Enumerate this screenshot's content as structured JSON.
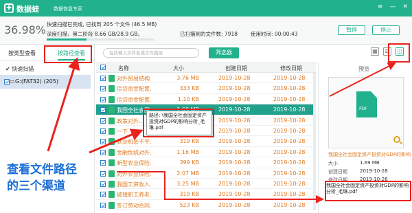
{
  "app": {
    "logo_glyph": "✚",
    "title": "数据蛙",
    "subtitle": "数据恢复专家",
    "controls": [
      "≡",
      "—",
      "✕"
    ]
  },
  "scan": {
    "percent": "36.98%",
    "line1": "快速扫描已完成, 已找到 205 个文件 (46.5 MB)",
    "line2": "深度扫描，第二阶段 8.66 GB/28.9 GB。",
    "progress_fraction": 0.3698,
    "found": "已扫描到的文件数:  7918",
    "time_used": "使用时间:  00:00:43",
    "pause_label": "暂停",
    "stop_label": "停止"
  },
  "left_panel": {
    "tab_type": "按类型查看",
    "tab_path": "按路径查看",
    "quick_scan": "快速扫描",
    "drive_label": "G:(FAT32) (205)"
  },
  "toolbar": {
    "search_placeholder": "在此输入文件名或文件路径",
    "filter_label": "筛选器",
    "view_icons": [
      "▦",
      "☰",
      "◫"
    ]
  },
  "table": {
    "columns": [
      "名称",
      "大小",
      "创建日期",
      "修改日期"
    ],
    "rows": [
      {
        "name": "对外贸易结构...",
        "size": "3.76 MB",
        "created": "2019-10-28",
        "modified": "2019-10-28",
        "selected": false
      },
      {
        "name": "信贷资金配置...",
        "size": "333 KB",
        "created": "2019-10-28",
        "modified": "2019-10-28",
        "selected": false
      },
      {
        "name": "信贷资金配置...",
        "size": "1.10 KB",
        "created": "2019-10-28",
        "modified": "2019-10-28",
        "selected": false
      },
      {
        "name": "我国全社会固...",
        "size": "1.69 MB",
        "created": "2019-10-28",
        "modified": "2019-10-28",
        "selected": true
      },
      {
        "name": "政策对外...",
        "size": "",
        "created": "2019-10-28",
        "modified": "2019-10-28",
        "selected": false
      },
      {
        "name": "一下...",
        "size": "",
        "created": "2019-10-28",
        "modified": "2019-10-28",
        "selected": false
      },
      {
        "name": "就业机会不平...",
        "size": "319 KB",
        "created": "2019-10-28",
        "modified": "2019-10-28",
        "selected": false
      },
      {
        "name": "金融危机对外...",
        "size": "1.16 MB",
        "created": "2019-10-28",
        "modified": "2019-10-28",
        "selected": false
      },
      {
        "name": "新型农业保险...",
        "size": "399 KB",
        "created": "2019-10-28",
        "modified": "2019-10-28",
        "selected": false
      },
      {
        "name": "对外农业保险...",
        "size": "2.07 MB",
        "created": "2019-10-28",
        "modified": "2019-10-28",
        "selected": false
      },
      {
        "name": "我国工资收入...",
        "size": "3.25 MB",
        "created": "2019-10-28",
        "modified": "2019-10-28",
        "selected": false
      },
      {
        "name": "城镇职工养老...",
        "size": "319 KB",
        "created": "2019-10-28",
        "modified": "2019-10-28",
        "selected": false
      },
      {
        "name": "签订劳动合同...",
        "size": "523 KB",
        "created": "2019-10-28",
        "modified": "2019-10-28",
        "selected": false
      }
    ]
  },
  "tooltip": {
    "text": "路径: \\我国全社会固定资产投资对GDP的影响分析_毛琳.pdf"
  },
  "preview": {
    "title": "预览",
    "file_type": "PDF",
    "file_name": "我国全社会固定资产投资对GDP的影响分析_毛琳.pdf",
    "size_label": "大小",
    "size_value": "1.69 MB",
    "created_label": "创建日期",
    "created_value": "2019-10-28",
    "modified_label": "修改日期",
    "modified_value": "2019-10-28",
    "path_text": "我国全社会固定资产投资对GDP的影响分析_毛琳.pdf"
  },
  "annotation": {
    "line1": "查看文件路径",
    "line2": "的三个渠道",
    "color": "#1b6fd6"
  },
  "colors": {
    "accent": "#21b18c",
    "highlight": "#e8231d",
    "file_text": "#e07b22"
  }
}
